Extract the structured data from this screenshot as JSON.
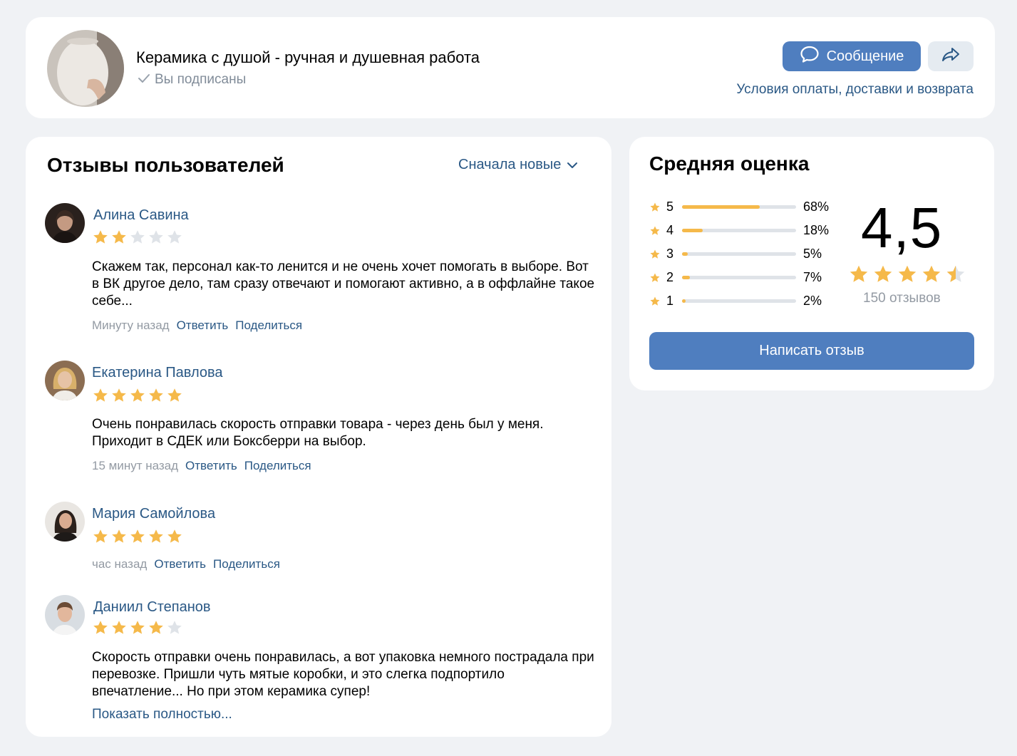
{
  "header": {
    "shop_title": "Керамика с душой - ручная и душевная работа",
    "subscribed_label": "Вы подписаны",
    "message_button": "Сообщение",
    "terms_link": "Условия оплаты, доставки и возврата"
  },
  "reviews": {
    "title": "Отзывы пользователей",
    "sort_label": "Сначала новые",
    "items": [
      {
        "name": "Алина Савина",
        "rating": 2,
        "text": "Скажем так, персонал как-то ленится и не очень хочет помогать в выборе. Вот в ВК другое дело, там сразу отвечают и помогают активно, а в оффлайне такое себе...",
        "time": "Минуту назад",
        "reply": "Ответить",
        "share": "Поделиться"
      },
      {
        "name": "Екатерина Павлова",
        "rating": 5,
        "text": "Очень понравилась скорость отправки товара - через день был у меня. Приходит в СДЕК или Боксберри на выбор.",
        "time": "15 минут назад",
        "reply": "Ответить",
        "share": "Поделиться"
      },
      {
        "name": "Мария Самойлова",
        "rating": 5,
        "text": "",
        "time": "час назад",
        "reply": "Ответить",
        "share": "Поделиться"
      },
      {
        "name": "Даниил Степанов",
        "rating": 4,
        "text": "Скорость отправки очень понравилась, а вот упаковка немного пострадала при перевозке. Пришли чуть мятые коробки, и это слегка подпортило впечатление... Но при этом керамика супер!",
        "show_more": "Показать полностью..."
      }
    ]
  },
  "rating": {
    "title": "Средняя оценка",
    "score": "4,5",
    "score_value": 4.5,
    "review_count": "150 отзывов",
    "write_button": "Написать отзыв",
    "distribution": [
      {
        "stars": "5",
        "percent": "68%",
        "value": 68
      },
      {
        "stars": "4",
        "percent": "18%",
        "value": 18
      },
      {
        "stars": "3",
        "percent": "5%",
        "value": 5
      },
      {
        "stars": "2",
        "percent": "7%",
        "value": 7
      },
      {
        "stars": "1",
        "percent": "2%",
        "value": 2
      }
    ]
  },
  "colors": {
    "accent": "#4f7ebf",
    "link": "#2a5885",
    "star": "#f5b94a",
    "star_empty": "#dfe3e8"
  }
}
